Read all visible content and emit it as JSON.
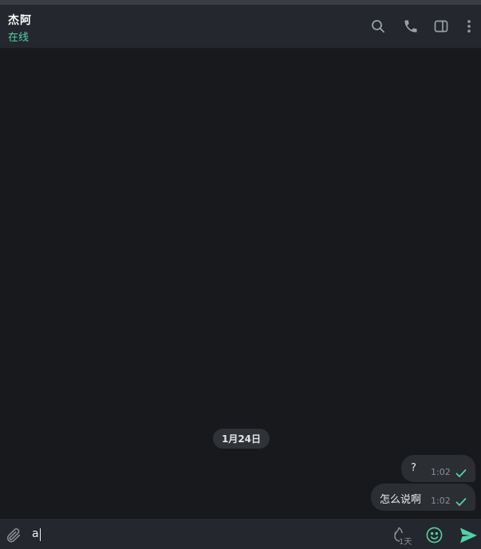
{
  "header": {
    "contact_name": "杰阿",
    "status": "在线",
    "icons": [
      "search-icon",
      "phone-icon",
      "sidebar-toggle-icon",
      "more-vertical-icon"
    ]
  },
  "chat": {
    "date_label": "1月24日",
    "messages": [
      {
        "text": "?",
        "time": "1:02",
        "status": "sent-check"
      },
      {
        "text": "怎么说啊",
        "time": "1:02",
        "status": "sent-check"
      }
    ]
  },
  "composer": {
    "input_value": "a",
    "timer_label": "1天",
    "icons": [
      "paperclip-icon",
      "self-destruct-timer-icon",
      "emoji-icon",
      "send-icon"
    ]
  },
  "colors": {
    "accent": "#4fd3a6",
    "header_bg": "#24272d",
    "chat_bg": "#18191c",
    "bubble_bg": "#2b2e33"
  }
}
